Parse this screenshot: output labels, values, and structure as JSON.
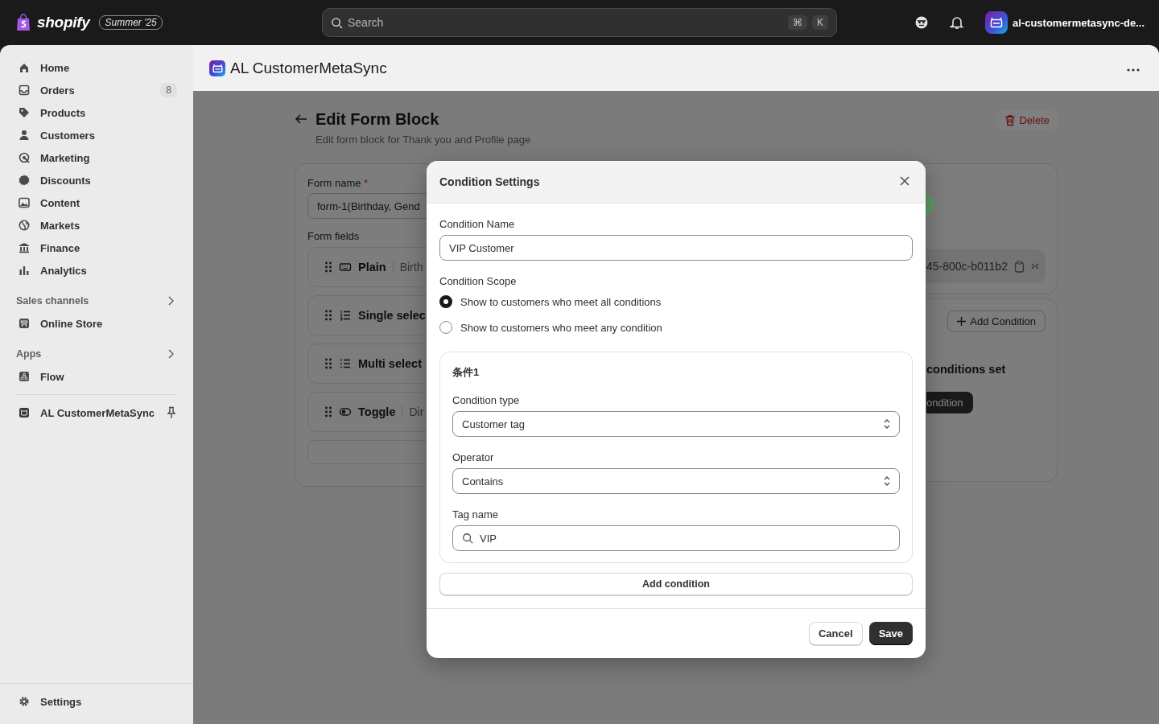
{
  "topbar": {
    "brand": "shopify",
    "edition": "Summer '25",
    "search": {
      "placeholder": "Search",
      "keys": [
        "⌘",
        "K"
      ]
    },
    "store": "al-customermetasync-de..."
  },
  "sidebar": {
    "items": [
      {
        "label": "Home",
        "kind": "home",
        "selected": false
      },
      {
        "label": "Orders",
        "kind": "orders",
        "badge": "8",
        "selected": false
      },
      {
        "label": "Products",
        "kind": "products",
        "selected": false
      },
      {
        "label": "Customers",
        "kind": "customers",
        "selected": false
      },
      {
        "label": "Marketing",
        "kind": "marketing",
        "selected": false
      },
      {
        "label": "Discounts",
        "kind": "discounts",
        "selected": false
      },
      {
        "label": "Content",
        "kind": "content",
        "selected": false
      },
      {
        "label": "Markets",
        "kind": "markets",
        "selected": false
      },
      {
        "label": "Finance",
        "kind": "finance",
        "selected": false
      },
      {
        "label": "Analytics",
        "kind": "analytics",
        "selected": false
      }
    ],
    "sections": [
      {
        "title": "Sales channels",
        "items": [
          {
            "label": "Online Store",
            "kind": "store",
            "selected": false
          }
        ]
      },
      {
        "title": "Apps",
        "items": [
          {
            "label": "Flow",
            "kind": "flow",
            "selected": false
          }
        ]
      }
    ],
    "pinned": {
      "label": "AL CustomerMetaSync",
      "kind": "app",
      "selected": false
    },
    "settings": {
      "label": "Settings",
      "kind": "settings",
      "selected": false
    }
  },
  "app_header": {
    "title": "AL CustomerMetaSync"
  },
  "page": {
    "title": "Edit Form Block",
    "subtitle": "Edit form block for Thank you and Profile page",
    "delete": "Delete",
    "form_name": {
      "label": "Form name",
      "required": "*",
      "value": "form-1(Birthday, Gend"
    },
    "form_fields": {
      "label": "Form fields",
      "items": [
        {
          "type": "Plain",
          "kind": "keyboard",
          "detail": "Birth"
        },
        {
          "type": "Single selec",
          "kind": "numbered"
        },
        {
          "type": "Multi select",
          "kind": "list"
        },
        {
          "type": "Toggle",
          "kind": "toggle",
          "detail": "Dir"
        }
      ]
    },
    "block_id": "45-800c-b011b2",
    "add_condition": "Add Condition",
    "empty_text": "conditions set",
    "condition_button": "ondition"
  },
  "modal": {
    "title": "Condition Settings",
    "name": {
      "label": "Condition Name",
      "value": "VIP Customer"
    },
    "scope": {
      "label": "Condition Scope",
      "options": [
        {
          "label": "Show to customers who meet all conditions",
          "selected": true
        },
        {
          "label": "Show to customers who meet any condition",
          "selected": false
        }
      ]
    },
    "conditions": [
      {
        "title": "条件1",
        "fields": [
          {
            "kind": "select",
            "label": "Condition type",
            "value": "Customer tag"
          },
          {
            "kind": "select",
            "label": "Operator",
            "value": "Contains"
          },
          {
            "kind": "search",
            "label": "Tag name",
            "value": "VIP"
          }
        ]
      }
    ],
    "add_condition": "Add condition",
    "cancel": "Cancel",
    "save": "Save"
  }
}
